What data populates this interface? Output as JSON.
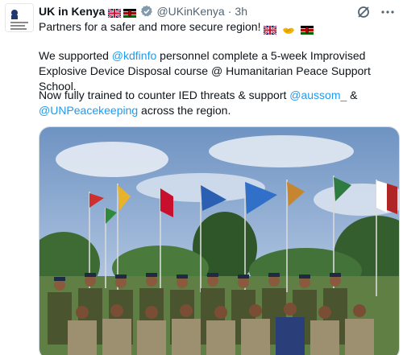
{
  "tweet": {
    "author_name": "UK in Kenya",
    "handle": "@UKinKenya",
    "separator": "·",
    "time": "3h",
    "line1_text": "Partners for a safer and more secure region!",
    "para2_prefix": "We supported ",
    "para2_mention": "@kdfinfo",
    "para2_suffix": " personnel complete a 5-week Improvised Explosive Device Disposal course @ Humanitarian Peace Support School.",
    "para3_prefix": "Now fully trained to counter IED threats & support ",
    "para3_mention1": "@aussom_",
    "para3_mid": " & ",
    "para3_mention2": "@UNPeacekeeping",
    "para3_suffix": " across the region."
  },
  "icons": {
    "verified": "verified-badge-icon",
    "grok": "grok-icon",
    "more": "more-icon",
    "flags": [
      "uk-flag-icon",
      "kenya-flag-icon",
      "handshake-icon"
    ]
  },
  "colors": {
    "link": "#1d9bf0",
    "secondary_text": "#536471",
    "primary_text": "#0f1419"
  }
}
